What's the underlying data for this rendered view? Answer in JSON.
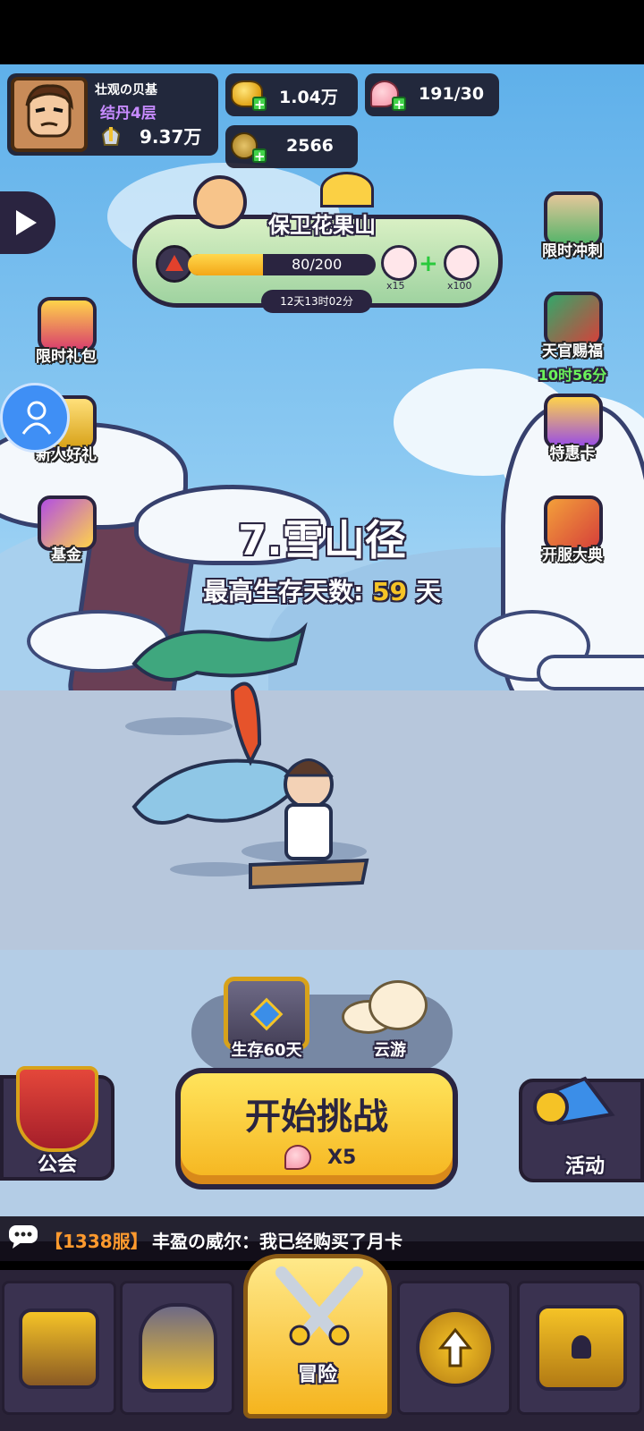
{
  "player": {
    "name": "壮观の贝基",
    "realm": "结丹4层",
    "power": "9.37万"
  },
  "resources": {
    "gold": "1.04万",
    "peach": "191/30",
    "copper": "2566"
  },
  "event": {
    "title": "保卫花果山",
    "progress_text": "80/200",
    "progress": 0.4,
    "reward_1_count": "x15",
    "reward_2_count": "x100",
    "timer": "12天13时02分"
  },
  "left_menu": {
    "gift_pack": "限时礼包",
    "newbie_gift": "新人好礼",
    "fund": "基金"
  },
  "right_menu": {
    "limited_sprint": "限时冲刺",
    "heavenly_blessing": "天官赐福",
    "blessing_timer": "10时56分",
    "special_card": "特惠卡",
    "server_ceremony": "开服大典"
  },
  "stage": {
    "name": "7.雪山径",
    "best_label": "最高生存天数:",
    "best_value": "59",
    "best_unit": "天"
  },
  "rewards": {
    "chest_label": "生存60天",
    "cloud_label": "云游"
  },
  "actions": {
    "guild": "公会",
    "start": "开始挑战",
    "cost": "X5",
    "activity": "活动"
  },
  "chat": {
    "server": "【1338服】",
    "message": "丰盈の威尔：我已经购买了月卡"
  },
  "nav": {
    "adventure": "冒险"
  },
  "colors": {
    "accent_yellow": "#f5c326",
    "timer_green": "#6bf25a",
    "server_orange": "#ff9a2e"
  }
}
